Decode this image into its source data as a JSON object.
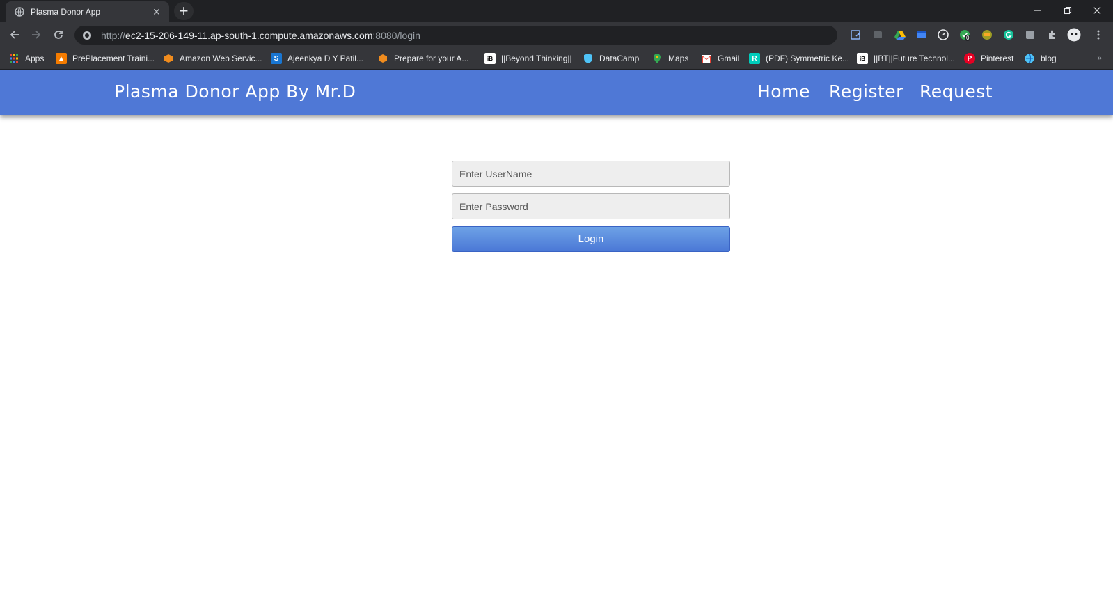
{
  "browser": {
    "tab": {
      "title": "Plasma Donor App",
      "close_glyph": "✕"
    },
    "new_tab_glyph": "+",
    "window_controls": [
      "minimize-icon",
      "restore-icon",
      "close-icon"
    ],
    "address": {
      "scheme": "http://",
      "host": "ec2-15-206-149-11.ap-south-1.compute.amazonaws.com",
      "path": ":8080/login"
    },
    "extensions": [
      "extension-icon-1",
      "extension-icon-2",
      "google-drive-icon",
      "extension-icon-4",
      "speedometer-icon",
      "checkmark-badge-icon",
      "extension-icon-7",
      "grammarly-icon",
      "extension-icon-9",
      "puzzle-icon",
      "profile-avatar-icon",
      "menu-dots-icon"
    ],
    "extension_badge": "0",
    "bookmarks": [
      {
        "label": "Apps",
        "icon": "apps-grid-icon",
        "color": "#ea4335"
      },
      {
        "label": "PrePlacement Traini...",
        "icon": "person-icon",
        "color": "#f57c00"
      },
      {
        "label": "Amazon Web Servic...",
        "icon": "aws-icon",
        "color": "#f08c1e"
      },
      {
        "label": "Ajeenkya D Y Patil...",
        "icon": "s-icon",
        "color": "#1976d2"
      },
      {
        "label": "Prepare for your A...",
        "icon": "aws-icon",
        "color": "#f08c1e"
      },
      {
        "label": "||Beyond Thinking||",
        "icon": "bt-icon",
        "color": "#ffffff"
      },
      {
        "label": "DataCamp",
        "icon": "shield-icon",
        "color": "#4fc3f7"
      },
      {
        "label": "Maps",
        "icon": "maps-icon",
        "color": "#34a853"
      },
      {
        "label": "Gmail",
        "icon": "gmail-icon",
        "color": "#ea4335"
      },
      {
        "label": "(PDF) Symmetric Ke...",
        "icon": "researchgate-icon",
        "color": "#00ccbb"
      },
      {
        "label": "||BT||Future Technol...",
        "icon": "bt-icon",
        "color": "#ffffff"
      },
      {
        "label": "Pinterest",
        "icon": "pinterest-icon",
        "color": "#e60023"
      },
      {
        "label": "blog",
        "icon": "globe-icon",
        "color": "#4fc3f7"
      }
    ],
    "bookmarks_overflow": "»"
  },
  "app": {
    "brand": "Plasma Donor App By Mr.D",
    "nav": {
      "home": "Home",
      "register": "Register",
      "request": "Request"
    },
    "login_form": {
      "username_placeholder": "Enter UserName",
      "password_placeholder": "Enter Password",
      "submit_label": "Login"
    },
    "colors": {
      "navbar": "#4f78d6",
      "button": "#5a8ade"
    }
  }
}
